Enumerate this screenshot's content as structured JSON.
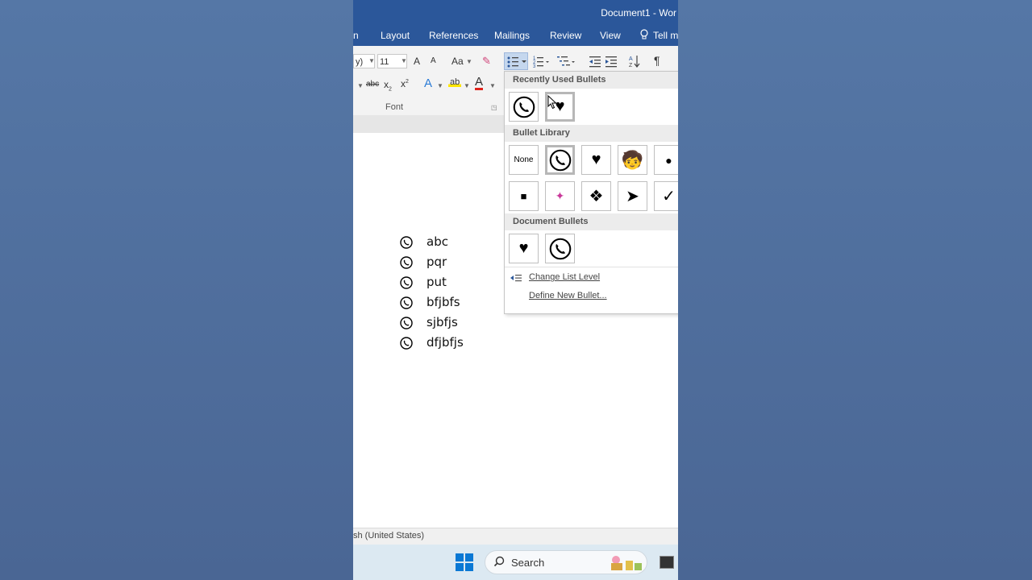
{
  "window": {
    "title": "Document1 - Wor"
  },
  "tabs": [
    "n",
    "Layout",
    "References",
    "Mailings",
    "Review",
    "View",
    "Tell m"
  ],
  "ribbon": {
    "font_name": "y)",
    "font_size": "11",
    "grow_label": "A",
    "shrink_label": "A",
    "case_label": "Aa",
    "strike_label": "abc",
    "sub_label": "x",
    "sup_label": "x",
    "effects_label": "A",
    "highlight_label": "ab",
    "color_label": "A",
    "pilcrow": "¶",
    "group_label": "Font"
  },
  "bullets_menu": {
    "recent_header": "Recently Used Bullets",
    "library_header": "Bullet Library",
    "document_header": "Document Bullets",
    "none_label": "None",
    "change_level": "Change List Level",
    "define_new": "Define New Bullet...",
    "heart": "♥",
    "dot": "●",
    "square": "■",
    "diamonds": "❖",
    "arrow": "➤",
    "check": "✓",
    "star": "✦",
    "person": "🧒"
  },
  "document": {
    "items": [
      "abc",
      "pqr",
      "put",
      "bfjbfs",
      "sjbfjs",
      "dfjbfjs"
    ]
  },
  "status": {
    "language": "sh (United States)"
  },
  "taskbar": {
    "search_label": "Search"
  },
  "colors": {
    "word_blue": "#2b579a",
    "desktop": "#4d6b99"
  }
}
